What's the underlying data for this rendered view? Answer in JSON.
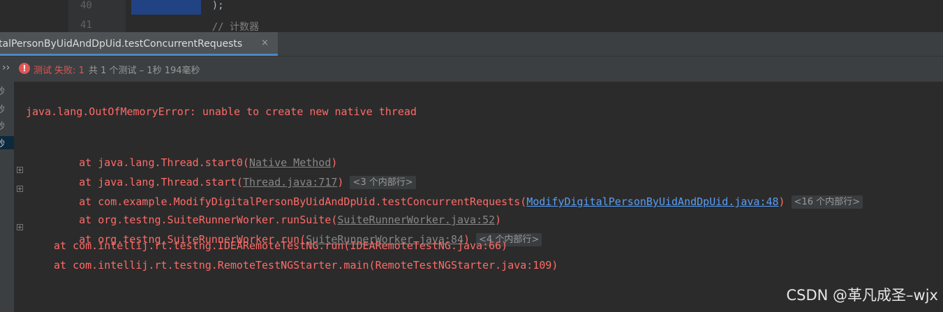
{
  "editor": {
    "line_numbers": [
      "40",
      "41"
    ],
    "code_lines": [
      "    );",
      "    // 计数器"
    ]
  },
  "tab": {
    "label": "talPersonByUidAndDpUid.testConcurrentRequests",
    "close": "×"
  },
  "status": {
    "chevron": "››",
    "error_icon": "!",
    "fail_label": "测试 失败: 1",
    "detail": "共 1 个测试 – 1秒 194毫秒"
  },
  "tree": {
    "items": [
      "秒",
      "秒",
      "秒",
      "秒"
    ],
    "selected_index": 3
  },
  "console": {
    "error_title": "java.lang.OutOfMemoryError: unable to create new native thread",
    "frames": [
      {
        "prefix": "at java.lang.Thread.start0(",
        "link": "Native Method",
        "suffix": ")",
        "fold": ""
      },
      {
        "prefix": "at java.lang.Thread.start(",
        "link": "Thread.java:717",
        "suffix": ")",
        "fold": "<3 个内部行>"
      },
      {
        "prefix": "at com.example.ModifyDigitalPersonByUidAndDpUid.testConcurrentRequests(",
        "link": "ModifyDigitalPersonByUidAndDpUid.java:48",
        "suffix": ")",
        "fold": "<16 个内部行>"
      },
      {
        "prefix": "at org.testng.SuiteRunnerWorker.runSuite(",
        "link": "SuiteRunnerWorker.java:52",
        "suffix": ")",
        "fold": ""
      },
      {
        "prefix": "at org.testng.SuiteRunnerWorker.run(",
        "link": "SuiteRunnerWorker.java:84",
        "suffix": ")",
        "fold": "<4 个内部行>"
      },
      {
        "text": "at com.intellij.rt.testng.IDEARemoteTestNG.run(IDEARemoteTestNG.java:66)"
      },
      {
        "text": "at com.intellij.rt.testng.RemoteTestNGStarter.main(RemoteTestNGStarter.java:109)"
      }
    ]
  },
  "watermark": "CSDN @革凡成圣–wjx",
  "colors": {
    "error_red": "#ff6b68",
    "link_blue": "#589df6",
    "accent_blue": "#4a88c7"
  }
}
